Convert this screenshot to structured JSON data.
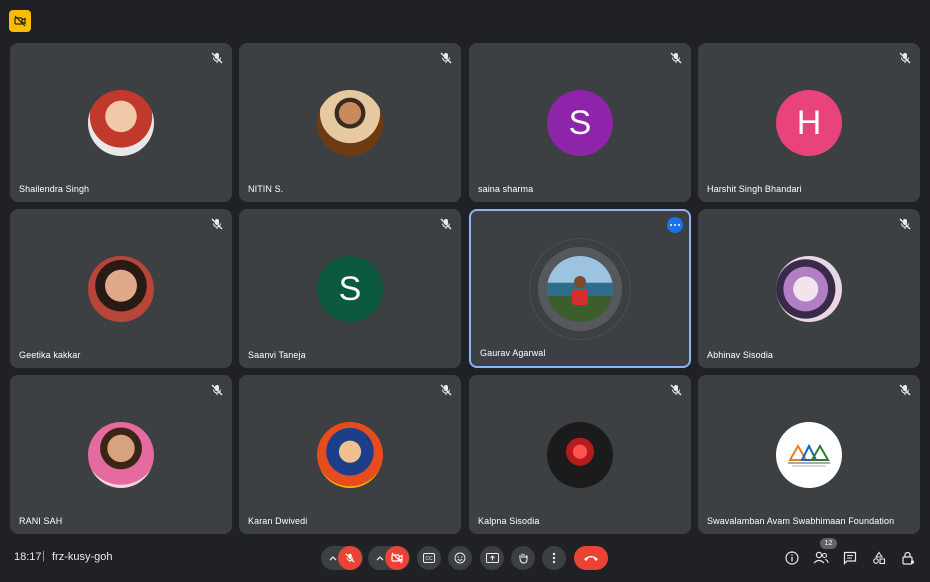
{
  "header": {
    "badge_icon": "no-video-icon"
  },
  "participants": [
    {
      "name": "Shailendra Singh",
      "avatar": "photo",
      "color": "#c0392b",
      "muted": true
    },
    {
      "name": "NITIN S.",
      "avatar": "photo",
      "color": "#8d5a2b",
      "muted": true
    },
    {
      "name": "saina sharma",
      "avatar": "S",
      "color": "#8e24aa",
      "muted": true
    },
    {
      "name": "Harshit Singh Bhandari",
      "avatar": "H",
      "color": "#e8437a",
      "muted": true
    },
    {
      "name": "Geetika kakkar",
      "avatar": "photo",
      "color": "#6b4a3a",
      "muted": true
    },
    {
      "name": "Saanvi Taneja",
      "avatar": "S",
      "color": "#0b5a3e",
      "muted": true
    },
    {
      "name": "Gaurav Agarwal",
      "avatar": "photo",
      "color": "#4f8fb8",
      "muted": false,
      "speaking": true
    },
    {
      "name": "Abhinav Sisodia",
      "avatar": "photo",
      "color": "#c9b2d6",
      "muted": true
    },
    {
      "name": "RANI SAH",
      "avatar": "photo",
      "color": "#e2a6b8",
      "muted": true
    },
    {
      "name": "Karan Dwivedi",
      "avatar": "photo",
      "color": "#d35400",
      "muted": true
    },
    {
      "name": "Kalpna Sisodia",
      "avatar": "photo",
      "color": "#1b1b1b",
      "muted": true
    },
    {
      "name": "Swavalamban Avam Swabhimaan Foundation",
      "avatar": "logo",
      "color": "#ffffff",
      "muted": true
    }
  ],
  "footer": {
    "time": "18:17",
    "separator": "|",
    "meeting_code": "frz-kusy-goh",
    "people_count": "12"
  }
}
